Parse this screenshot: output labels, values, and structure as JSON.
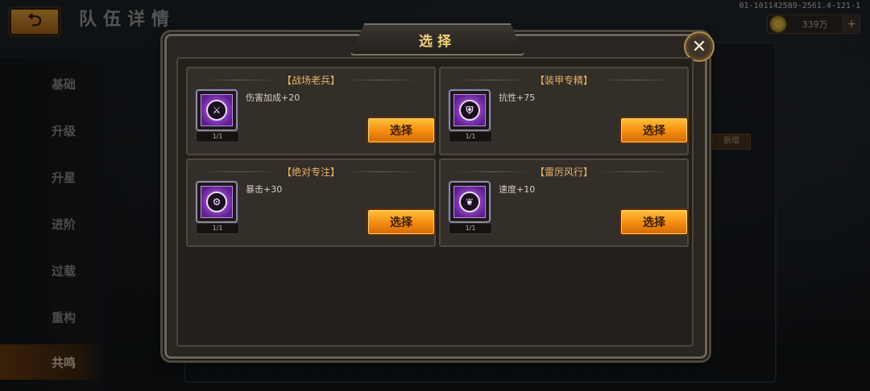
{
  "header": {
    "title": "队伍详情",
    "build_id": "01-101142589-2561.4-121-1",
    "currency_value": "339万"
  },
  "sidebar": {
    "items": [
      {
        "label": "基础"
      },
      {
        "label": "升级"
      },
      {
        "label": "升星"
      },
      {
        "label": "进阶"
      },
      {
        "label": "过载"
      },
      {
        "label": "重构"
      },
      {
        "label": "共鸣"
      }
    ],
    "active_index": 6
  },
  "background": {
    "new_button_label": "新增"
  },
  "modal": {
    "title": "选择",
    "close_icon": "close-icon",
    "cards": [
      {
        "title": "【战场老兵】",
        "effect": "伤害加成+20",
        "level": "1/1",
        "button": "选择",
        "icon": "sword-icon"
      },
      {
        "title": "【装甲专精】",
        "effect": "抗性+75",
        "level": "1/1",
        "button": "选择",
        "icon": "shield-icon"
      },
      {
        "title": "【绝对专注】",
        "effect": "暴击+30",
        "level": "1/1",
        "button": "选择",
        "icon": "gear-icon"
      },
      {
        "title": "【雷厉风行】",
        "effect": "速度+10",
        "level": "1/1",
        "button": "选择",
        "icon": "leaf-icon"
      }
    ]
  },
  "colors": {
    "accent_orange": "#f58a10",
    "title_gold": "#f0d27a",
    "card_title": "#e7b36a",
    "icon_purple": "#a450d8"
  }
}
